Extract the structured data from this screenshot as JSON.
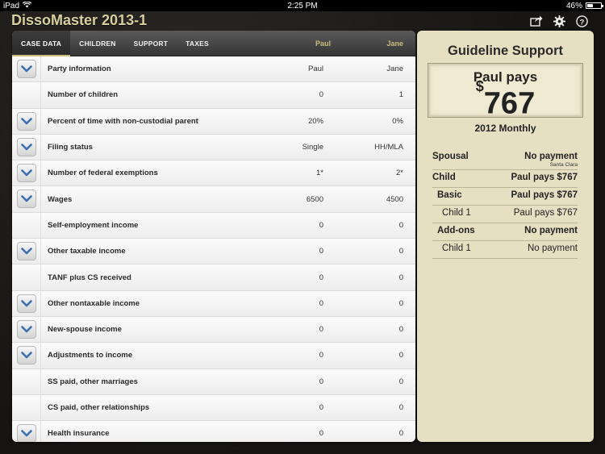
{
  "statusbar": {
    "device": "iPad",
    "time": "2:25 PM",
    "battery": "46%",
    "battery_level": 0.46
  },
  "app": {
    "title": "DissoMaster 2013-1",
    "icons": [
      "share-icon",
      "gear-icon",
      "help-icon"
    ]
  },
  "tabs": [
    {
      "label": "CASE DATA",
      "active": true
    },
    {
      "label": "CHILDREN",
      "active": false
    },
    {
      "label": "SUPPORT",
      "active": false
    },
    {
      "label": "TAXES",
      "active": false
    }
  ],
  "columns": {
    "paul": "Paul",
    "jane": "Jane"
  },
  "rows": [
    {
      "label": "Party information",
      "paul": "Paul",
      "jane": "Jane",
      "expandable": true
    },
    {
      "label": "Number of children",
      "paul": "0",
      "jane": "1",
      "expandable": false
    },
    {
      "label": "Percent of time with non-custodial parent",
      "paul": "20%",
      "jane": "0%",
      "expandable": true
    },
    {
      "label": "Filing status",
      "paul": "Single",
      "jane": "HH/MLA",
      "expandable": true
    },
    {
      "label": "Number of federal exemptions",
      "paul": "1*",
      "jane": "2*",
      "expandable": true
    },
    {
      "label": "Wages",
      "paul": "6500",
      "jane": "4500",
      "expandable": true
    },
    {
      "label": "Self-employment income",
      "paul": "0",
      "jane": "0",
      "expandable": false
    },
    {
      "label": "Other taxable income",
      "paul": "0",
      "jane": "0",
      "expandable": true
    },
    {
      "label": "TANF plus CS received",
      "paul": "0",
      "jane": "0",
      "expandable": false
    },
    {
      "label": "Other nontaxable income",
      "paul": "0",
      "jane": "0",
      "expandable": true
    },
    {
      "label": "New-spouse income",
      "paul": "0",
      "jane": "0",
      "expandable": true
    },
    {
      "label": "Adjustments to income",
      "paul": "0",
      "jane": "0",
      "expandable": true
    },
    {
      "label": "SS paid, other marriages",
      "paul": "0",
      "jane": "0",
      "expandable": false
    },
    {
      "label": "CS paid, other relationships",
      "paul": "0",
      "jane": "0",
      "expandable": false
    },
    {
      "label": "Health insurance",
      "paul": "0",
      "jane": "0",
      "expandable": true
    }
  ],
  "guideline": {
    "title": "Guideline Support",
    "payer": "Paul pays",
    "currency": "$",
    "amount": "767",
    "period": "2012 Monthly",
    "county": "Santa Clara",
    "summary": [
      {
        "key": "Spousal",
        "value": "No payment",
        "level": 0,
        "note": "Santa Clara"
      },
      {
        "key": "Child",
        "value": "Paul pays $767",
        "level": 0
      },
      {
        "key": "Basic",
        "value": "Paul pays $767",
        "level": 1
      },
      {
        "key": "Child 1",
        "value": "Paul pays $767",
        "level": 2
      },
      {
        "key": "Add-ons",
        "value": "No payment",
        "level": 1
      },
      {
        "key": "Child 1",
        "value": "No payment",
        "level": 2
      }
    ]
  },
  "colors": {
    "accent": "#c8bd7a",
    "title": "#d8cf9c",
    "panel_right": "#e6dfc2",
    "chevron": "#3a6fb0"
  }
}
